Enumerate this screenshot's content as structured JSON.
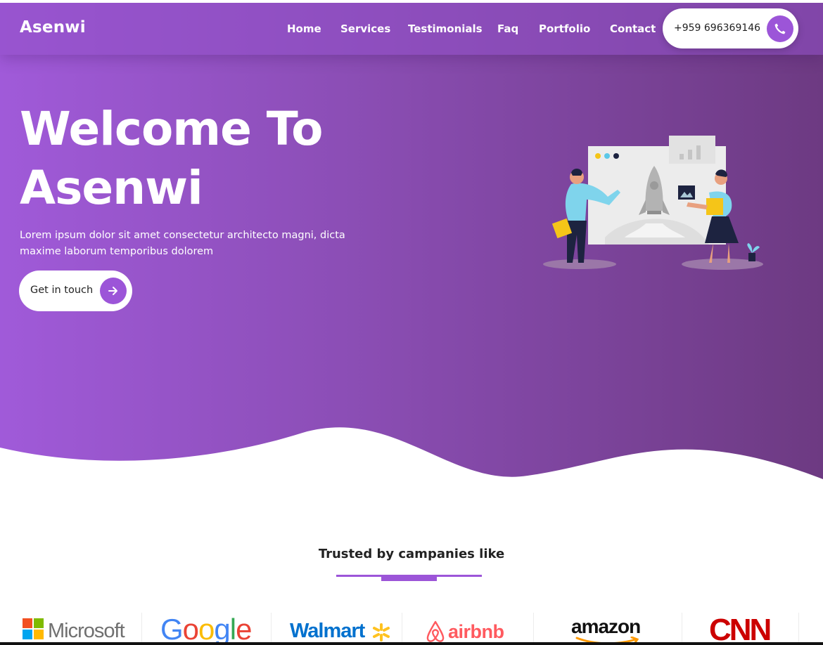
{
  "header": {
    "brand": "Asenwi",
    "nav": [
      "Home",
      "Services",
      "Testimonials",
      "Faq",
      "Portfolio",
      "Contact"
    ],
    "phone": "+959 696369146",
    "phone_icon": "phone-icon"
  },
  "hero": {
    "title_line1": "Welcome To",
    "title_line2": "Asenwi",
    "subtitle": "Lorem ipsum dolor sit amet consectetur architecto magni, dicta maxime laborum temporibus dolorem",
    "cta_label": "Get in touch",
    "cta_icon": "arrow-right-icon",
    "illustration": "team-rocket-presentation-illustration"
  },
  "trusted": {
    "heading": "Trusted by campanies like",
    "logos": [
      "Microsoft",
      "Google",
      "Walmart",
      "airbnb",
      "amazon",
      "CNN"
    ]
  },
  "colors": {
    "accent": "#9c55d8",
    "gradient_start": "#a05ad9",
    "gradient_end": "#6d3a82",
    "text_dark": "#222222",
    "white": "#ffffff"
  }
}
